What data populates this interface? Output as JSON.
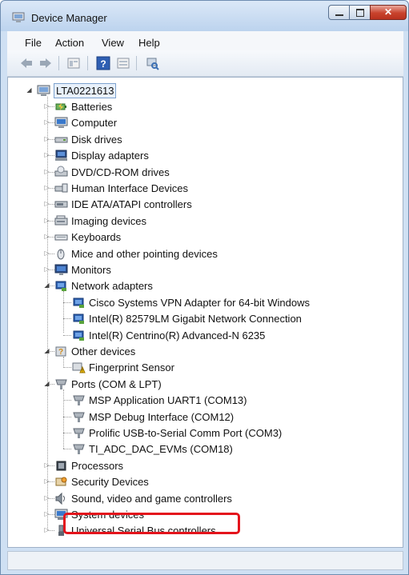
{
  "window": {
    "title": "Device Manager"
  },
  "menu": [
    "File",
    "Action",
    "View",
    "Help"
  ],
  "toolbar": [
    "back-arrow-icon",
    "forward-arrow-icon",
    "properties-sheet-icon",
    "help-icon",
    "view-sheet-icon",
    "scan-hardware-icon"
  ],
  "tree": {
    "root": "LTA0221613",
    "items": [
      {
        "label": "Batteries",
        "icon": "battery-icon",
        "expander": "closed"
      },
      {
        "label": "Computer",
        "icon": "computer-icon",
        "expander": "closed"
      },
      {
        "label": "Disk drives",
        "icon": "disk-drive-icon",
        "expander": "closed"
      },
      {
        "label": "Display adapters",
        "icon": "display-adapter-icon",
        "expander": "closed"
      },
      {
        "label": "DVD/CD-ROM drives",
        "icon": "dvd-drive-icon",
        "expander": "closed"
      },
      {
        "label": "Human Interface Devices",
        "icon": "hid-icon",
        "expander": "closed"
      },
      {
        "label": "IDE ATA/ATAPI controllers",
        "icon": "ide-controller-icon",
        "expander": "closed"
      },
      {
        "label": "Imaging devices",
        "icon": "imaging-device-icon",
        "expander": "closed"
      },
      {
        "label": "Keyboards",
        "icon": "keyboard-icon",
        "expander": "closed"
      },
      {
        "label": "Mice and other pointing devices",
        "icon": "mouse-icon",
        "expander": "closed"
      },
      {
        "label": "Monitors",
        "icon": "monitor-icon",
        "expander": "closed"
      },
      {
        "label": "Network adapters",
        "icon": "network-adapter-icon",
        "expander": "open"
      },
      {
        "label": "Cisco Systems VPN Adapter for 64-bit Windows",
        "icon": "network-adapter-icon",
        "child": true
      },
      {
        "label": "Intel(R) 82579LM Gigabit Network Connection",
        "icon": "network-adapter-icon",
        "child": true
      },
      {
        "label": "Intel(R) Centrino(R) Advanced-N 6235",
        "icon": "network-adapter-icon",
        "child": true
      },
      {
        "label": "Other devices",
        "icon": "unknown-device-icon",
        "expander": "open"
      },
      {
        "label": "Fingerprint Sensor",
        "icon": "warning-device-icon",
        "child": true
      },
      {
        "label": "Ports (COM & LPT)",
        "icon": "port-connector-icon",
        "expander": "open"
      },
      {
        "label": "MSP Application UART1 (COM13)",
        "icon": "port-connector-icon",
        "child": true
      },
      {
        "label": "MSP Debug Interface (COM12)",
        "icon": "port-connector-icon",
        "child": true
      },
      {
        "label": "Prolific USB-to-Serial Comm Port (COM3)",
        "icon": "port-connector-icon",
        "child": true
      },
      {
        "label": "TI_ADC_DAC_EVMs (COM18)",
        "icon": "port-connector-icon",
        "child": true,
        "highlighted": true
      },
      {
        "label": "Processors",
        "icon": "processor-icon",
        "expander": "closed"
      },
      {
        "label": "Security Devices",
        "icon": "security-device-icon",
        "expander": "closed"
      },
      {
        "label": "Sound, video and game controllers",
        "icon": "sound-icon",
        "expander": "closed"
      },
      {
        "label": "System devices",
        "icon": "system-device-icon",
        "expander": "closed"
      },
      {
        "label": "Universal Serial Bus controllers",
        "icon": "usb-icon",
        "expander": "closed"
      }
    ]
  },
  "colors": {
    "highlight_border": "#e4141c",
    "title_bar": "#cfe0f3",
    "selection": "#e8f1fb"
  }
}
